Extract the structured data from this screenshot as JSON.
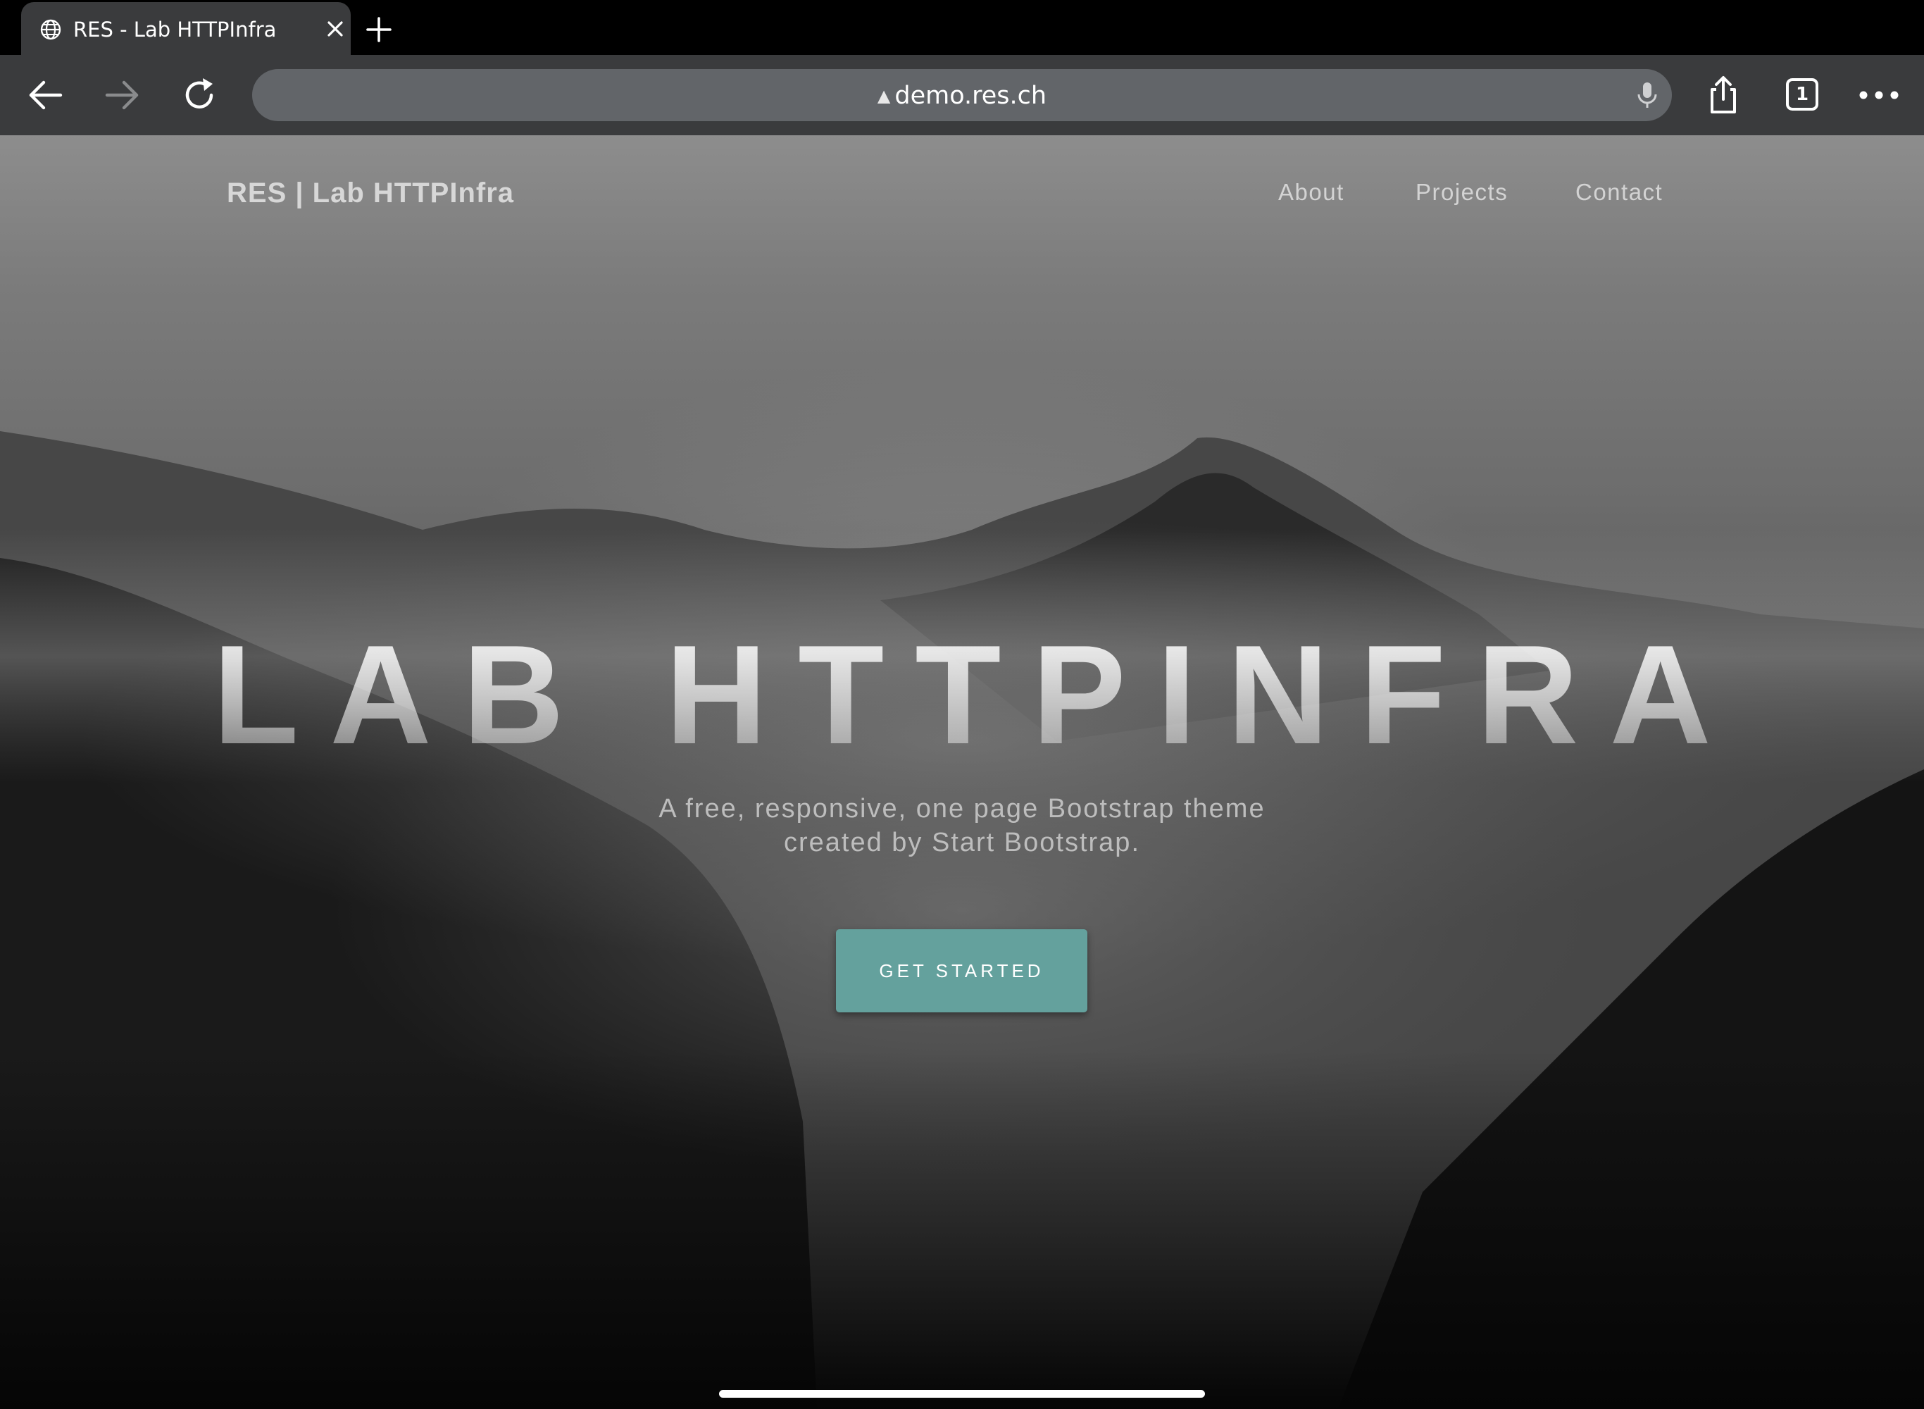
{
  "browser": {
    "tab": {
      "title": "RES - Lab HTTPInfra",
      "favicon": "globe-icon",
      "close_icon": "close-icon"
    },
    "new_tab_icon": "plus-icon",
    "toolbar": {
      "back_icon": "arrow-left-icon",
      "forward_icon": "arrow-right-icon",
      "reload_icon": "reload-icon",
      "url": "demo.res.ch",
      "security_icon": "warning-triangle-icon",
      "mic_icon": "microphone-icon",
      "share_icon": "share-icon",
      "tabs_count": "1",
      "more_icon": "more-dots-icon"
    }
  },
  "page": {
    "navbar": {
      "brand": "RES | Lab HTTPInfra",
      "links": [
        "About",
        "Projects",
        "Contact"
      ]
    },
    "hero": {
      "title": "Lab HTTPInfra",
      "subtitle_line1": "A free, responsive, one page Bootstrap theme",
      "subtitle_line2": "created by Start Bootstrap.",
      "button": "Get Started"
    }
  },
  "colors": {
    "accent": "#64a19d",
    "chrome": "#3a3b3d",
    "urlbar": "#626569"
  }
}
